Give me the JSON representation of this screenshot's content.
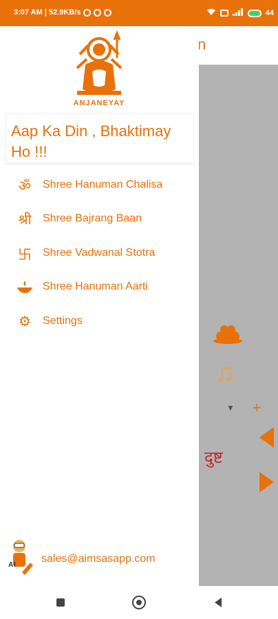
{
  "status_bar": {
    "time_speed": "3:07 AM | 52.9KB/s",
    "battery": "44"
  },
  "background_app": {
    "title_fragment": "n",
    "devanagari_text": "दुष्ट"
  },
  "drawer": {
    "logo_text": "ANJANEYAY",
    "greeting": "Aap Ka Din , Bhaktimay Ho !!!",
    "menu": [
      {
        "label": "Shree Hanuman Chalisa",
        "icon": "om-icon"
      },
      {
        "label": "Shree Bajrang Baan",
        "icon": "shree-icon"
      },
      {
        "label": "Shree Vadwanal Stotra",
        "icon": "swastik-icon"
      },
      {
        "label": "Shree Hanuman Aarti",
        "icon": "diya-icon"
      },
      {
        "label": "Settings",
        "icon": "gear-icon"
      }
    ],
    "footer_email": "sales@aimsasapp.com"
  },
  "colors": {
    "accent": "#e8710a",
    "status_bar": "#e8710a",
    "scrim": "#b3b3b3"
  }
}
